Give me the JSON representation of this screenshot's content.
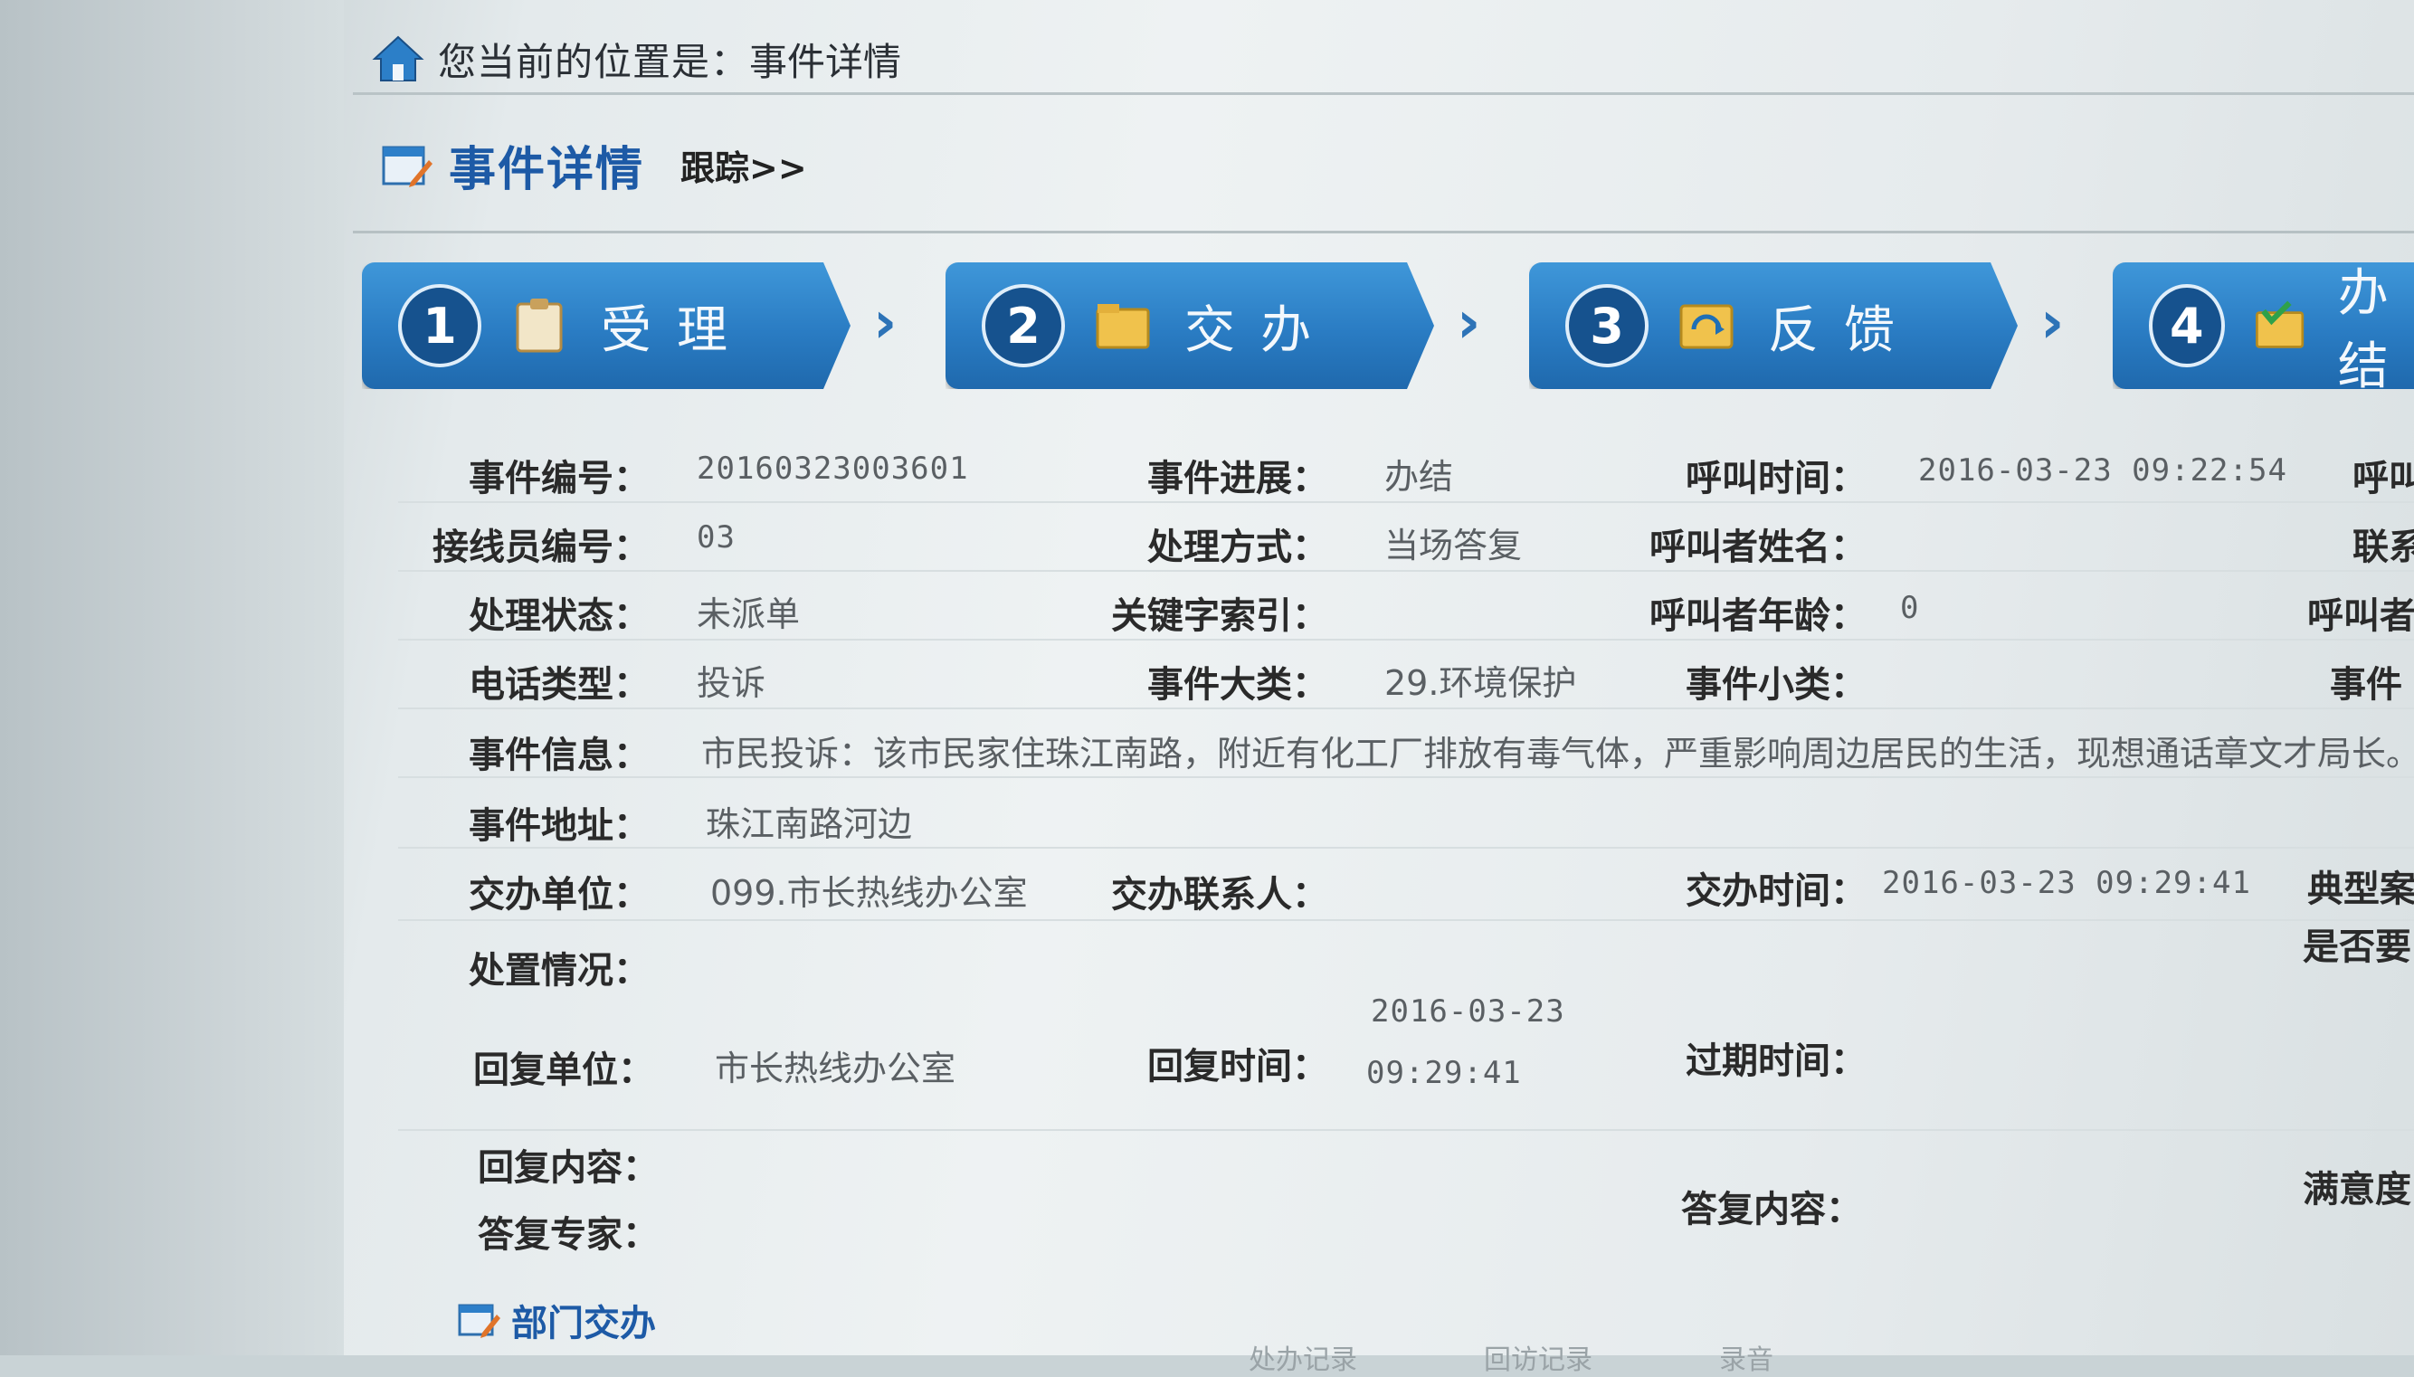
{
  "breadcrumb": {
    "prefix": "您当前的位置是：",
    "current": "事件详情"
  },
  "page": {
    "title": "事件详情",
    "track_link": "跟踪>>"
  },
  "steps": [
    {
      "num": "1",
      "label": "受理",
      "icon": "clipboard-icon"
    },
    {
      "num": "2",
      "label": "交办",
      "icon": "folder-icon"
    },
    {
      "num": "3",
      "label": "反馈",
      "icon": "feedback-icon"
    },
    {
      "num": "4",
      "label": "办结",
      "icon": "check-folder-icon"
    }
  ],
  "step_arrow": "›",
  "fields": {
    "event_no_label": "事件编号：",
    "event_no": "20160323003601",
    "progress_label": "事件进展：",
    "progress": "办结",
    "call_time_label": "呼叫时间：",
    "call_time": "2016-03-23 09:22:54",
    "col4_r1": "呼叫",
    "operator_label": "接线员编号：",
    "operator": "03",
    "method_label": "处理方式：",
    "method": "当场答复",
    "caller_name_label": "呼叫者姓名：",
    "caller_name": "",
    "col4_r2": "联系",
    "status_label": "处理状态：",
    "status": "未派单",
    "keyword_label": "关键字索引：",
    "keyword": "",
    "caller_age_label": "呼叫者年龄：",
    "caller_age": "0",
    "col4_r3": "呼叫者",
    "phone_type_label": "电话类型：",
    "phone_type": "投诉",
    "category_label": "事件大类：",
    "category": "29.环境保护",
    "subcategory_label": "事件小类：",
    "subcategory": "",
    "col4_r4": "事件",
    "info_label": "事件信息：",
    "info": "市民投诉：该市民家住珠江南路，附近有化工厂排放有毒气体，严重影响周边居民的生活，现想通话章文才局长。",
    "address_label": "事件地址：",
    "address": "珠江南路河边",
    "assign_unit_label": "交办单位：",
    "assign_unit": "099.市长热线办公室",
    "assign_contact_label": "交办联系人：",
    "assign_contact": "",
    "assign_time_label": "交办时间：",
    "assign_time": "2016-03-23 09:29:41",
    "col4_r7": "典型案",
    "col4_r8": "是否要",
    "disposal_label": "处置情况：",
    "disposal": "",
    "reply_unit_label": "回复单位：",
    "reply_unit": "市长热线办公室",
    "reply_time_label": "回复时间：",
    "reply_time_date": "2016-03-23",
    "reply_time_clock": "09:29:41",
    "expire_label": "过期时间：",
    "expire": "",
    "reply_content_label": "回复内容：",
    "reply_content": "",
    "expert_label": "答复专家：",
    "expert": "",
    "answer_content_label": "答复内容：",
    "answer_content": "",
    "satisfaction_label": "满意度："
  },
  "section": {
    "dept_title": "部门交办"
  },
  "footer_faint": [
    "处办记录",
    "回访记录",
    "录音"
  ],
  "colors": {
    "accent": "#1d5aa6",
    "step_blue": "#2a7cc3"
  }
}
